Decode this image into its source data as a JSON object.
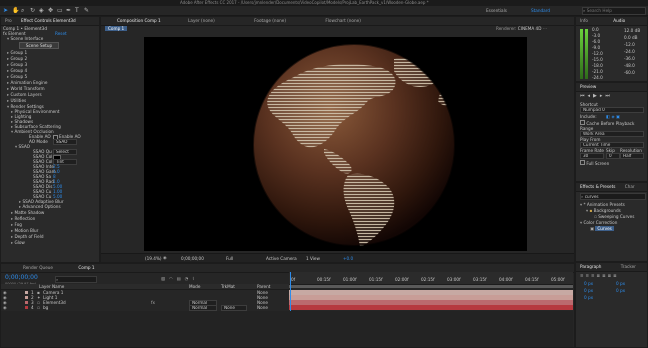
{
  "window": {
    "title": "Adobe After Effects CC 2017 - /Users/jmnlender/Documents/VideoCopilot/Models/ProjLab_EarthPack_v1/Wooden-Globe.aep *"
  },
  "toolbar": {
    "workspaces": [
      "Essentials",
      "Standard"
    ],
    "search_placeholder": "Search Help"
  },
  "effect_controls": {
    "tab": "Effect Controls Element3d",
    "project_tab": "Pro",
    "header": "Comp 1 • Element3d",
    "fx_name": "Element",
    "reset": "Reset",
    "items": [
      "Scene Interface",
      "Scene Setup",
      "Group 1",
      "Group 2",
      "Group 3",
      "Group 4",
      "Group 5",
      "Animation Engine",
      "World Transform",
      "Custom Layers",
      "Utilities",
      "Render Settings",
      "Physical Environment",
      "Lighting",
      "Shadows",
      "Subsurface Scattering",
      "Ambient Occlusion",
      "Enable AO",
      "AO Mode",
      "SSAO",
      "SSAO Qu",
      "SSAO Col",
      "SSAO Col",
      "SSAO Inte",
      "SSAO Gam",
      "SSAO Sa",
      "SSAO Rad",
      "SSAO Dis",
      "SSAO Cu",
      "SSAO Cu",
      "SSAO Adaptive Blur",
      "Advanced Options",
      "Matte Shadow",
      "Reflection",
      "Fog",
      "Motion Blur",
      "Depth of Field",
      "Glow"
    ],
    "values": {
      "enable_ao_2": "Enable AO",
      "ao_mode": "SSAO",
      "ssao_quality": "Select",
      "ssao_color": "Tint",
      "ssao_intensity": "2.5",
      "ssao_gamma": "1.0",
      "ssao_samples": "8",
      "ssao_radius": "1.0",
      "ssao_distance": "5.00",
      "ssao_curve_1": "1.00",
      "ssao_curve_2": "5.00"
    }
  },
  "composition": {
    "tab": "Composition Comp 1",
    "layer_tab": "Layer (none)",
    "footage_tab": "Footage (none)",
    "flowchart_tab": "Flowchart (none)",
    "subtab": "Comp 1",
    "renderer_label": "Renderer:",
    "renderer": "CINEMA 4D",
    "footer": {
      "zoom": "(19.4%)",
      "timecode": "0;00;00;00",
      "quality": "Full",
      "camera": "Active Camera",
      "views": "1 View",
      "offset": "+0.0"
    }
  },
  "info": {
    "tabs": [
      "Info",
      "Audio"
    ],
    "db_scale": [
      "0.0",
      "-3.0",
      "-6.0",
      "-9.0",
      "-12.0",
      "-15.0",
      "-18.0",
      "-21.0",
      "-24.0"
    ],
    "db_right": [
      "12.0 dB",
      "0.0 dB",
      "-12.0",
      "-24.0",
      "-36.0",
      "-48.0",
      "-60.0"
    ]
  },
  "preview": {
    "title": "Preview",
    "shortcut_label": "Shortcut",
    "shortcut": "Numpad 0",
    "include_label": "Include:",
    "cache": "Cache Before Playback",
    "range_label": "Range",
    "range": "Work Area",
    "play_from_label": "Play From",
    "play_from": "Current Time",
    "frame_rate_label": "Frame Rate",
    "skip_label": "Skip",
    "resolution_label": "Resolution",
    "frame_rate": "30",
    "skip": "0",
    "resolution": "Half",
    "full_screen": "Full Screen"
  },
  "effects_presets": {
    "tabs": [
      "Effects & Presets",
      "Char"
    ],
    "search": "curves",
    "tree": [
      "* Animation Presets",
      "Backgrounds",
      "Sweeping Curves",
      "Color Correction",
      "Curves"
    ]
  },
  "paragraph": {
    "tabs": [
      "Paragraph",
      "Tracker"
    ],
    "values": [
      "0 px",
      "0 px",
      "0 px",
      "0 px",
      "0 px"
    ]
  },
  "timeline": {
    "tabs": [
      "Render Queue",
      "Comp 1"
    ],
    "timecode": "0;00;00;00",
    "fps_hint": "00000 (29.97 fps)",
    "columns": {
      "source": "Layer Name",
      "mode": "Mode",
      "trkmat": "TrkMat",
      "parent": "Parent"
    },
    "ruler": [
      "0f",
      "00:15f",
      "01:00f",
      "01:15f",
      "02:00f",
      "02:15f",
      "03:00f",
      "03:15f",
      "04:00f",
      "04:15f",
      "05:00f"
    ],
    "layers": [
      {
        "num": "1",
        "name": "Camera 1",
        "mode": "",
        "trkmat": "",
        "parent": "None",
        "color": "#c7a9a3"
      },
      {
        "num": "2",
        "name": "Light 1",
        "mode": "",
        "trkmat": "",
        "parent": "None",
        "color": "#c89d97"
      },
      {
        "num": "3",
        "name": "Element3d",
        "mode": "Normal",
        "trkmat": "",
        "parent": "None",
        "color": "#bb6a6e"
      },
      {
        "num": "4",
        "name": "bg",
        "mode": "Normal",
        "trkmat": "None",
        "parent": "None",
        "color": "#b6393f"
      }
    ]
  }
}
